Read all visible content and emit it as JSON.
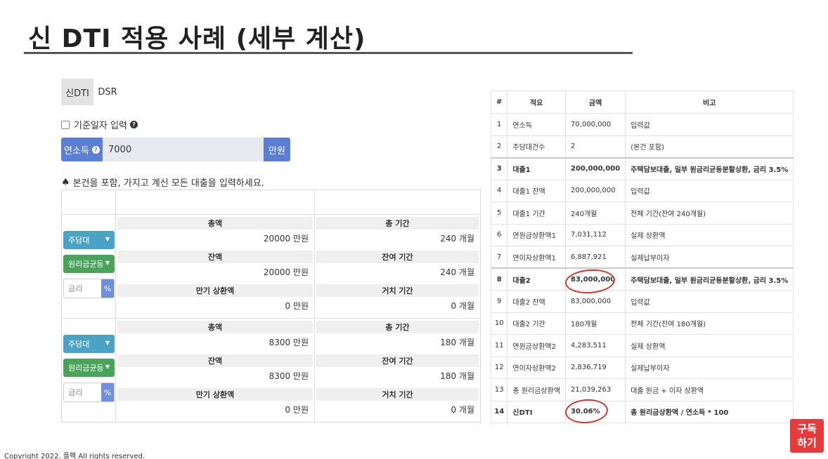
{
  "title": "신 DTI 적용 사례 (세부 계산)",
  "tabs": [
    {
      "label": "신DTI",
      "active": true
    },
    {
      "label": "DSR",
      "active": false
    }
  ],
  "base_date_checkbox": {
    "label": "기준일자 입력",
    "checked": false
  },
  "income": {
    "label": "연소득",
    "value": "7000",
    "unit": "만원"
  },
  "note": "본건을 포함, 가지고 계신 모든 대출을 입력하세요.",
  "loans": [
    {
      "type": "주담대",
      "repayment": "원리금균등",
      "rate_placeholder": "금리",
      "rate_unit": "%",
      "total_label": "총액",
      "total_value": "20000 만원",
      "period_label": "총 기간",
      "period_value": "240 개월",
      "balance_label": "잔액",
      "balance_value": "20000 만원",
      "remain_label": "잔여 기간",
      "remain_value": "240 개월",
      "maturity_label": "만기 상환액",
      "maturity_value": "0 만원",
      "grace_label": "거치 기간",
      "grace_value": "0 개월"
    },
    {
      "type": "주담대",
      "repayment": "원리금균등",
      "rate_placeholder": "금리",
      "rate_unit": "%",
      "total_label": "총액",
      "total_value": "8300 만원",
      "period_label": "총 기간",
      "period_value": "180 개월",
      "balance_label": "잔액",
      "balance_value": "8300 만원",
      "remain_label": "잔여 기간",
      "remain_value": "180 개월",
      "maturity_label": "만기 상환액",
      "maturity_value": "0 만원",
      "grace_label": "거치 기간",
      "grace_value": "0 개월"
    }
  ],
  "table": {
    "headers": [
      "#",
      "적요",
      "금액",
      "비고"
    ],
    "rows": [
      {
        "no": "1",
        "summary": "연소득",
        "amount": "70,000,000",
        "remark": "입력값",
        "bold": false
      },
      {
        "no": "2",
        "summary": "주담대건수",
        "amount": "2",
        "remark": "(본건 포함)",
        "bold": false
      },
      {
        "no": "3",
        "summary": "대출1",
        "amount": "200,000,000",
        "remark": "주택담보대출, 일부 원금리균등분할상환, 금리 3.5%",
        "bold": true
      },
      {
        "no": "4",
        "summary": "대출1 잔액",
        "amount": "200,000,000",
        "remark": "입력값",
        "bold": false
      },
      {
        "no": "5",
        "summary": "대출1 기간",
        "amount": "240개월",
        "remark": "전체 기간(잔여 240개월)",
        "bold": false
      },
      {
        "no": "6",
        "summary": "연원금상환액1",
        "amount": "7,031,112",
        "remark": "실제 상환액",
        "bold": false
      },
      {
        "no": "7",
        "summary": "연이자상환액1",
        "amount": "6,887,921",
        "remark": "실제납부이자",
        "bold": false
      },
      {
        "no": "8",
        "summary": "대출2",
        "amount": "83,000,000",
        "remark": "주택담보대출, 일부 원금리균등분할상환, 금리 3.5%",
        "bold": true
      },
      {
        "no": "9",
        "summary": "대출2 잔액",
        "amount": "83,000,000",
        "remark": "입력값",
        "bold": false
      },
      {
        "no": "10",
        "summary": "대출2 기간",
        "amount": "180개월",
        "remark": "전체 기간(잔여 180개월)",
        "bold": false
      },
      {
        "no": "11",
        "summary": "연원금상환액2",
        "amount": "4,283,511",
        "remark": "실제 상환액",
        "bold": false
      },
      {
        "no": "12",
        "summary": "연이자상환액2",
        "amount": "2,836,719",
        "remark": "실제납부이자",
        "bold": false
      },
      {
        "no": "13",
        "summary": "총 원리금상환액",
        "amount": "21,039,263",
        "remark": "대출 원금 + 이자 상환액",
        "bold": false
      },
      {
        "no": "14",
        "summary": "신DTI",
        "amount": "30.06%",
        "remark": "총 원리금상환액 / 연소득 * 100",
        "bold": true
      }
    ]
  },
  "copyright": "Copyright 2022. 플팩 All rights reserved.",
  "subscribe": {
    "line1": "구독",
    "line2": "하기"
  },
  "colors": {
    "accent_blue": "#5b7fd2",
    "control_teal": "#4aa3c4",
    "control_green": "#4aa35a",
    "highlight_red": "#d4372c",
    "subscribe_red": "#e63b3b"
  }
}
